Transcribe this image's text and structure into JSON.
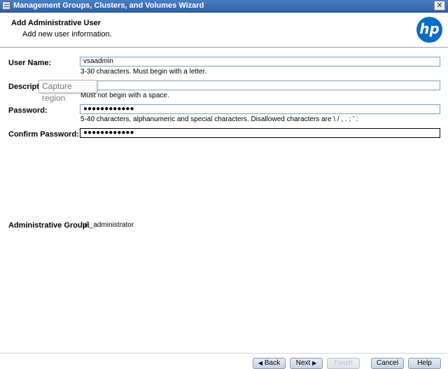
{
  "window": {
    "title": "Management Groups, Clusters, and Volumes Wizard",
    "close_glyph": "✕"
  },
  "header": {
    "title": "Add Administrative User",
    "subtitle": "Add new user information.",
    "logo_text": "hp"
  },
  "form": {
    "user_name": {
      "label": "User Name:",
      "value": "vsaadmin",
      "hint": "3-30 characters. Must begin with a letter."
    },
    "description": {
      "label": "Descripti",
      "value": "",
      "hint": "Must not begin with a space."
    },
    "password": {
      "label": "Password:",
      "value": "●●●●●●●●●●●●",
      "hint": "5-40 characters, alphanumeric and special characters. Disallowed characters are \\ / , . ; ' :"
    },
    "confirm_password": {
      "label": "Confirm Password:",
      "value": "●●●●●●●●●●●●"
    },
    "admin_group": {
      "label": "Administrative Group:",
      "value": "full_administrator"
    }
  },
  "tooltip": {
    "text": "Capture region"
  },
  "buttons": {
    "back": "Back",
    "next": "Next",
    "finish": "Finish",
    "cancel": "Cancel",
    "help": "Help"
  },
  "colors": {
    "titlebar": "#2f62a8",
    "brand": "#0b6cc6"
  }
}
